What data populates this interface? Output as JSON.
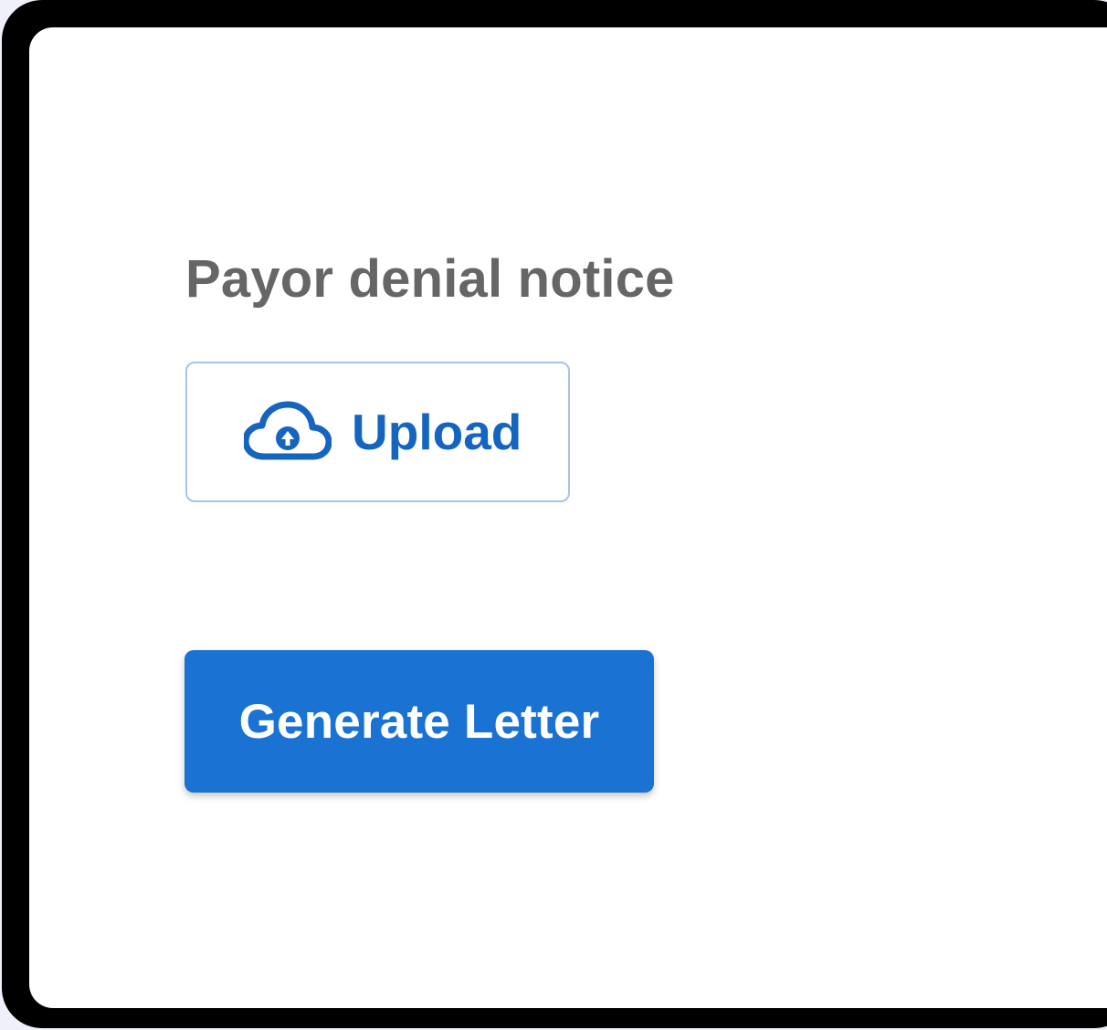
{
  "field": {
    "label": "Payor denial notice",
    "upload_button": {
      "icon": "cloud-upload-icon",
      "label": "Upload"
    }
  },
  "actions": {
    "generate_label": "Generate Letter"
  },
  "colors": {
    "primary": "#1a73d2",
    "upload_text": "#1565c0",
    "upload_border": "#a9c2ea",
    "label_text": "#666666",
    "frame": "#000000",
    "backdrop": "#f0f0fb"
  }
}
